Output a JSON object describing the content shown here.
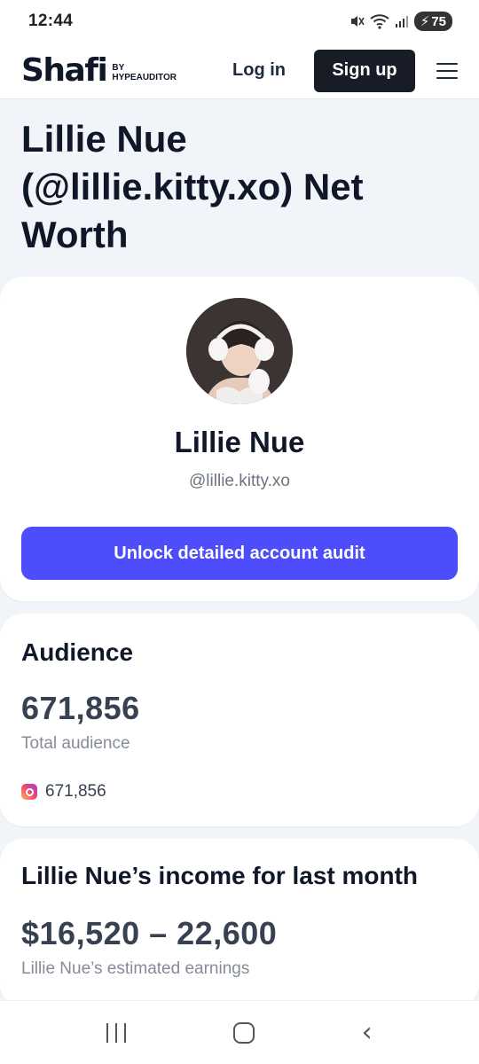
{
  "status_bar": {
    "time": "12:44",
    "battery": "75",
    "icons": [
      "mute-icon",
      "wifi-icon",
      "signal-icon",
      "battery-charging-icon"
    ]
  },
  "header": {
    "logo_word": "Shafi",
    "logo_by": "BY",
    "logo_brand": "HYPEAUDITOR",
    "login_label": "Log in",
    "signup_label": "Sign up",
    "menu_icon": "hamburger-menu-icon"
  },
  "page": {
    "title": "Lillie Nue (@lillie.kitty.xo) Net Worth"
  },
  "profile": {
    "name": "Lillie Nue",
    "handle": "@lillie.kitty.xo",
    "unlock_label": "Unlock detailed account audit"
  },
  "audience": {
    "title": "Audience",
    "total": "671,856",
    "total_label": "Total audience",
    "instagram_count": "671,856",
    "instagram_icon": "instagram-icon"
  },
  "income": {
    "title": "Lillie Nue’s income for last month",
    "range": "$16,520 – 22,600",
    "label": "Lillie Nue’s estimated earnings"
  },
  "nav_bar": {
    "icons": [
      "recent-apps-icon",
      "home-icon",
      "back-icon"
    ]
  },
  "colors": {
    "accent": "#4e4dfb",
    "signup_bg": "#171c26",
    "page_bg": "#f1f4f8"
  }
}
